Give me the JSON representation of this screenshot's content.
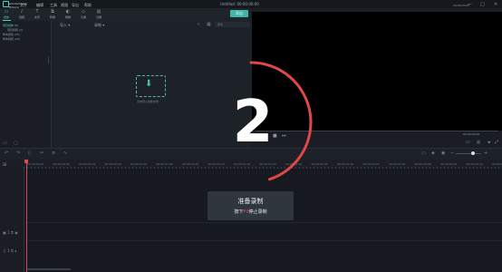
{
  "app": {
    "logo_text": "wondershare filmora",
    "window_title": "Untitled: 00:00:00:00",
    "menu": [
      "文件",
      "编辑",
      "工具",
      "视图",
      "导出",
      "帮助"
    ],
    "window_controls": [
      "—",
      "□",
      "✕"
    ]
  },
  "toolbar": {
    "items": [
      {
        "label": "媒体",
        "icon": "folder-icon"
      },
      {
        "label": "音频",
        "icon": "music-note-icon"
      },
      {
        "label": "文字",
        "icon": "text-icon"
      },
      {
        "label": "转场",
        "icon": "transition-icon"
      },
      {
        "label": "特效",
        "icon": "effects-icon"
      },
      {
        "label": "元素",
        "icon": "elements-icon"
      },
      {
        "label": "分屏",
        "icon": "split-screen-icon"
      }
    ],
    "export_label": "导出"
  },
  "sidebar": {
    "items": [
      "项目媒体 (0)",
      "项目剪辑 (0)",
      "样本颜色 (25)",
      "样本视频 (20)"
    ]
  },
  "media_bar": {
    "import_label": "导入",
    "record_label": "录制",
    "search_placeholder": "搜索"
  },
  "drop_zone": {
    "text": "点击导入媒体文件"
  },
  "preview": {
    "timecode": "00:00:00:00",
    "timecode_top": "00:00:00:00"
  },
  "timeline": {
    "ruler_labels": [
      "00:00:00:00",
      "00:00:00:05",
      "00:00:00:10",
      "00:00:00:15",
      "00:00:00:20",
      "00:00:01:00",
      "00:00:01:05",
      "00:00:01:10",
      "00:00:01:15",
      "00:00:01:20",
      "00:00:02:00",
      "00:00:02:05",
      "00:00:02:10",
      "00:00:02:15",
      "00:00:02:20",
      "00:00:03:00",
      "00:00:03:05",
      "00:00:03:10",
      "00:00:03:15"
    ],
    "tracks": [
      "1",
      "1"
    ]
  },
  "countdown": {
    "number": "2",
    "accent_color": "#e04848",
    "progress": 0.45
  },
  "record_notice": {
    "title": "准备录制",
    "sub_prefix": "按下",
    "sub_key": "F9",
    "sub_suffix": "停止录制"
  }
}
